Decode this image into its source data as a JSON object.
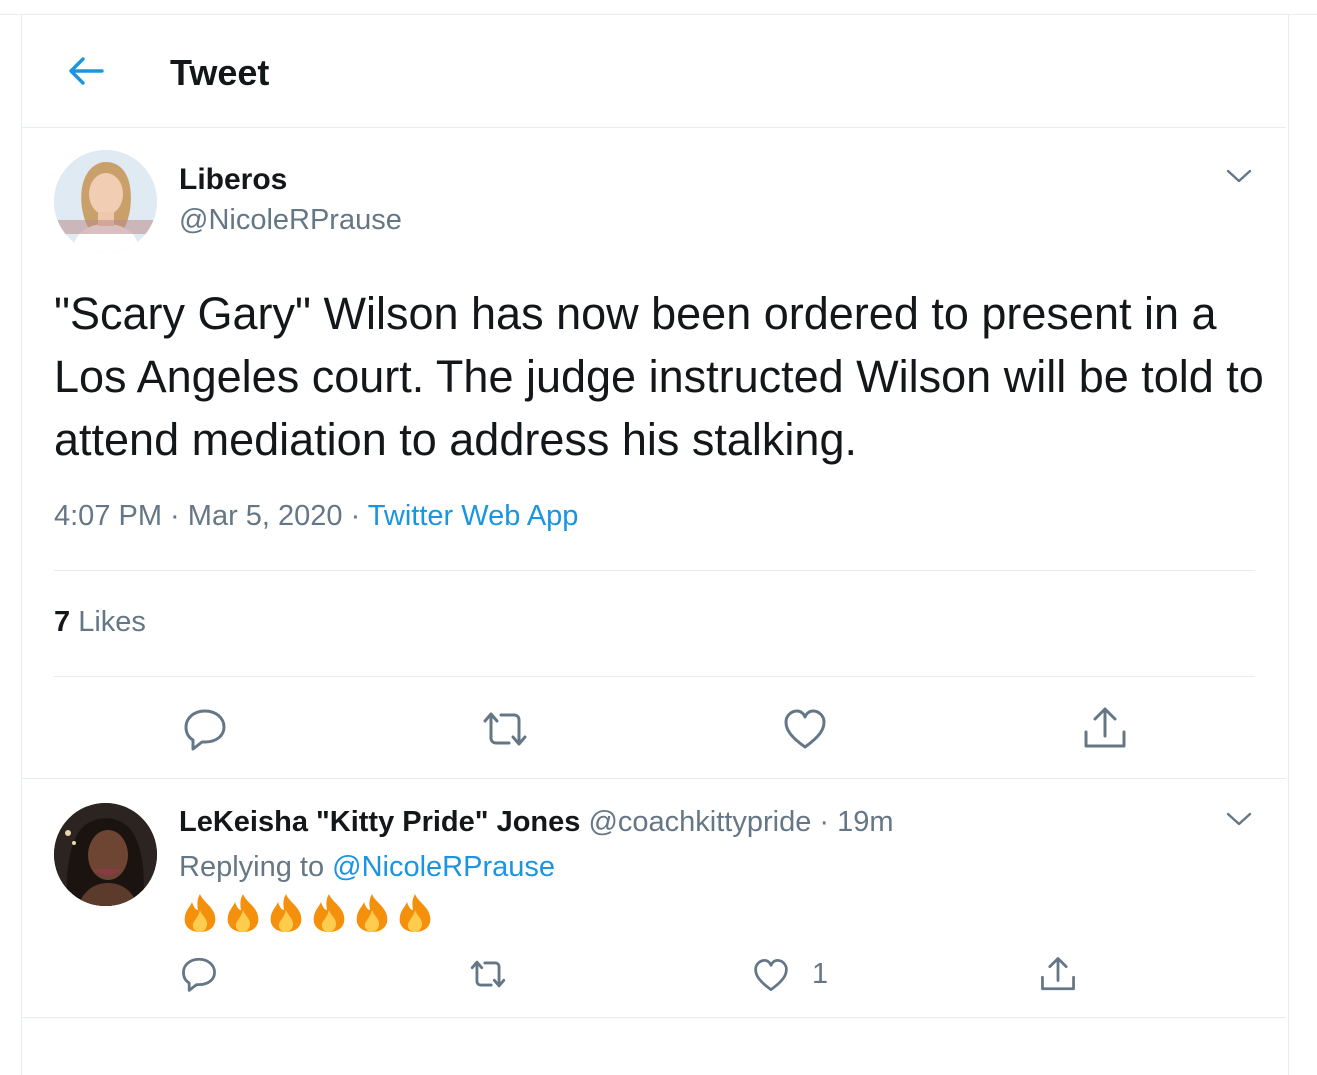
{
  "header": {
    "title": "Tweet"
  },
  "tweet": {
    "author_name": "Liberos",
    "author_handle": "@NicoleRPrause",
    "text": "\"Scary Gary\" Wilson has now been ordered to present in a Los Angeles court. The judge instructed Wilson will be told to attend mediation to address his stalking.",
    "time": "4:07 PM",
    "sep1": " · ",
    "date": "Mar 5, 2020",
    "sep2": " · ",
    "source": "Twitter Web App",
    "likes_count": "7",
    "likes_label": " Likes",
    "actions": [
      "reply-icon",
      "retweet-icon",
      "like-icon",
      "share-icon"
    ]
  },
  "reply": {
    "author_name": "LeKeisha \"Kitty Pride\" Jones",
    "author_handle": "@coachkittypride",
    "sep": " · ",
    "time": "19m",
    "replying_prefix": "Replying to ",
    "replying_to": "@NicoleRPrause",
    "emoji_count": 6,
    "emoji_icon": "fire-emoji",
    "like_count": "1"
  },
  "colors": {
    "accent": "#1b95e0",
    "secondary_text": "#657786",
    "divider": "#e6ecf0",
    "fire": "#f4900c"
  }
}
